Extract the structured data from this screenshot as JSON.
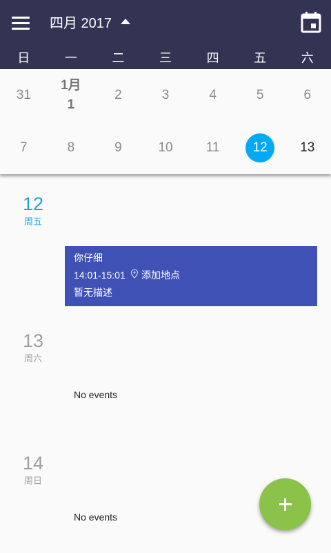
{
  "header": {
    "month_title": "四月 2017",
    "menu_icon": "hamburger-menu-icon",
    "caret_icon": "caret-up-icon",
    "today_icon": "calendar-today-icon",
    "background_color": "#333354"
  },
  "weekdays": [
    "日",
    "一",
    "二",
    "三",
    "四",
    "五",
    "六"
  ],
  "month_grid": {
    "week1": [
      "31",
      "1月",
      "2",
      "3",
      "4",
      "5",
      "6"
    ],
    "week1_first_day": "1",
    "week2": [
      "7",
      "8",
      "9",
      "10",
      "11",
      "12",
      "13"
    ],
    "selected_day": "12",
    "selected_color": "#03a9f4"
  },
  "agenda": {
    "days": [
      {
        "day": "12",
        "weekday": "周五"
      },
      {
        "day": "13",
        "weekday": "周六"
      },
      {
        "day": "14",
        "weekday": "周日"
      }
    ],
    "event": {
      "title": "你仔细",
      "time": "14:01-15:01",
      "location": "添加地点",
      "description": "暂无描述",
      "color": "#3f51b5"
    },
    "no_events_label": "No events"
  },
  "fab": {
    "icon": "plus-icon",
    "color": "#8bc34a"
  }
}
